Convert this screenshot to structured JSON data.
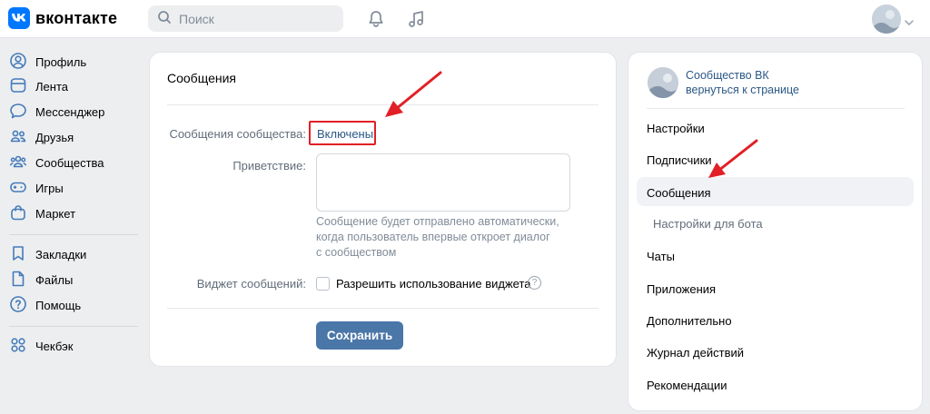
{
  "header": {
    "logo_text": "вконтакте",
    "search_placeholder": "Поиск",
    "icons": [
      "vk-logo-icon",
      "search-icon",
      "bell-icon",
      "music-icon",
      "chevron-down-icon"
    ]
  },
  "leftnav": {
    "items": [
      {
        "label": "Профиль",
        "icon": "profile-icon"
      },
      {
        "label": "Лента",
        "icon": "feed-icon"
      },
      {
        "label": "Мессенджер",
        "icon": "messenger-icon"
      },
      {
        "label": "Друзья",
        "icon": "friends-icon"
      },
      {
        "label": "Сообщества",
        "icon": "communities-icon"
      },
      {
        "label": "Игры",
        "icon": "gamepad-icon"
      },
      {
        "label": "Маркет",
        "icon": "market-bag-icon"
      },
      {
        "label": "Закладки",
        "icon": "bookmark-icon"
      },
      {
        "label": "Файлы",
        "icon": "file-icon"
      },
      {
        "label": "Помощь",
        "icon": "help-icon"
      },
      {
        "label": "Чекбэк",
        "icon": "checkback-icon"
      }
    ]
  },
  "main": {
    "title": "Сообщения",
    "community_messages_label": "Сообщения сообщества:",
    "community_messages_value": "Включены",
    "greeting_label": "Приветствие:",
    "greeting_value": "",
    "hint_line1": "Сообщение будет отправлено автоматически,",
    "hint_line2": "когда пользователь впервые откроет диалог",
    "hint_line3": "с сообществом",
    "widget_label": "Виджет сообщений:",
    "widget_checkbox_label": "Разрешить использование виджета",
    "widget_checked": false,
    "help_mark": "?",
    "save_label": "Сохранить"
  },
  "side": {
    "community_name": "Сообщество ВК",
    "back_link": "вернуться к странице",
    "menu": [
      {
        "label": "Настройки"
      },
      {
        "label": "Подписчики"
      },
      {
        "label": "Сообщения",
        "active": true
      },
      {
        "label": "Настройки для бота",
        "sub": true
      },
      {
        "label": "Чаты"
      },
      {
        "label": "Приложения"
      },
      {
        "label": "Дополнительно"
      },
      {
        "label": "Журнал действий"
      },
      {
        "label": "Рекомендации"
      }
    ]
  },
  "colors": {
    "accent": "#0077ff",
    "link": "#2a5885",
    "button": "#4a76a8",
    "annotation_red": "#e21f26",
    "background": "#edeef0"
  }
}
